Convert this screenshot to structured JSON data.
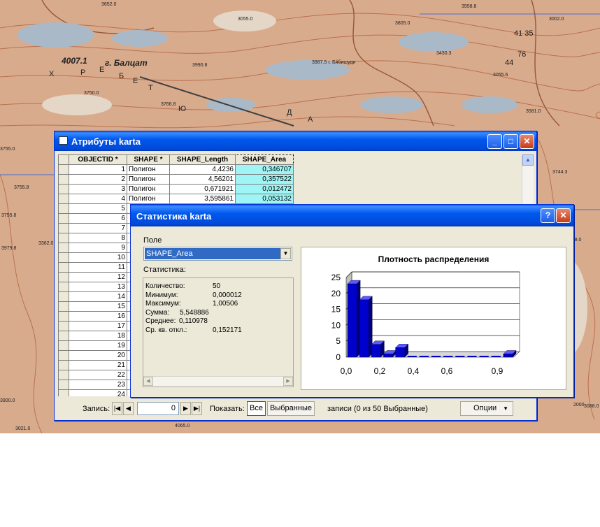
{
  "map": {
    "labels": [
      "4007.1",
      "г. Балцат",
      "Х",
      "Р",
      "Е",
      "Б",
      "Е",
      "Т",
      "Ю",
      "Д",
      "А",
      "3990.8",
      "3750.0",
      "3766.8",
      "3055.0",
      "3805.0",
      "3430.3",
      "3987.5 г. Бйбишуди",
      "3055.6",
      "3581.0",
      "3744.3",
      "3755.8",
      "3362.0",
      "3002.0",
      "41 35",
      "44",
      "76",
      "3652.0",
      "3558.8",
      "2000",
      "4065.0",
      "3755.0",
      "3788.0",
      "3979.8",
      "3088.0",
      "3755.8",
      "3021.0",
      "3900.0"
    ]
  },
  "attributes_window": {
    "title": "Атрибуты karta",
    "columns": [
      "OBJECTID *",
      "SHAPE *",
      "SHAPE_Length",
      "SHAPE_Area"
    ],
    "rows": [
      [
        "1",
        "Полигон",
        "4,4236",
        "0,346707"
      ],
      [
        "2",
        "Полигон",
        "4,56201",
        "0,357522"
      ],
      [
        "3",
        "Полигон",
        "0,671921",
        "0,012472"
      ],
      [
        "4",
        "Полигон",
        "3,595861",
        "0,053132"
      ],
      [
        "5",
        "",
        "",
        ""
      ],
      [
        "6",
        "",
        "",
        ""
      ],
      [
        "7",
        "",
        "",
        ""
      ],
      [
        "8",
        "",
        "",
        ""
      ],
      [
        "9",
        "",
        "",
        ""
      ],
      [
        "10",
        "",
        "",
        ""
      ],
      [
        "11",
        "",
        "",
        ""
      ],
      [
        "12",
        "",
        "",
        ""
      ],
      [
        "13",
        "",
        "",
        ""
      ],
      [
        "14",
        "",
        "",
        ""
      ],
      [
        "15",
        "",
        "",
        ""
      ],
      [
        "16",
        "",
        "",
        ""
      ],
      [
        "17",
        "",
        "",
        ""
      ],
      [
        "18",
        "",
        "",
        ""
      ],
      [
        "19",
        "",
        "",
        ""
      ],
      [
        "20",
        "",
        "",
        ""
      ],
      [
        "21",
        "",
        "",
        ""
      ],
      [
        "22",
        "",
        "",
        ""
      ],
      [
        "23",
        "",
        "",
        ""
      ],
      [
        "24",
        "",
        "",
        ""
      ]
    ],
    "footer": {
      "record_label": "Запись:",
      "record_value": "0",
      "show_label": "Показать:",
      "all_label": "Все",
      "selected_label": "Выбранные",
      "records_info": "записи (0 из 50 Выбранные)",
      "options_label": "Опции"
    }
  },
  "statistics_dialog": {
    "title": "Статистика karta",
    "field_label": "Поле",
    "field_value": "SHAPE_Area",
    "stats_label": "Статистика:",
    "stats": [
      {
        "label": "Количество:",
        "value": "50"
      },
      {
        "label": "Минимум:",
        "value": "0,000012"
      },
      {
        "label": "Максимум:",
        "value": "1,00506"
      },
      {
        "label": "Сумма:",
        "value": "5,548886"
      },
      {
        "label": "Среднее:",
        "value": "0,110978"
      },
      {
        "label": "Ср. кв. откл.:",
        "value": "0,152171"
      }
    ]
  },
  "chart_data": {
    "type": "bar",
    "title": "Плотность распределения",
    "xlabel": "",
    "ylabel": "",
    "ylim": [
      0,
      25
    ],
    "ytick_labels": [
      "0",
      "5",
      "10",
      "15",
      "20",
      "25"
    ],
    "xtick_labels": [
      "0,0",
      "0,2",
      "0,4",
      "0,6",
      "0,9"
    ],
    "values": [
      23,
      18,
      4,
      1,
      3,
      0,
      0,
      0,
      0,
      0,
      0,
      0,
      0,
      1
    ],
    "bar_color": "#0000cc",
    "grid": true
  },
  "colors": {
    "title_bar": "#0058ee",
    "highlight": "#316ac5",
    "selected_column": "#9ff5f5"
  }
}
